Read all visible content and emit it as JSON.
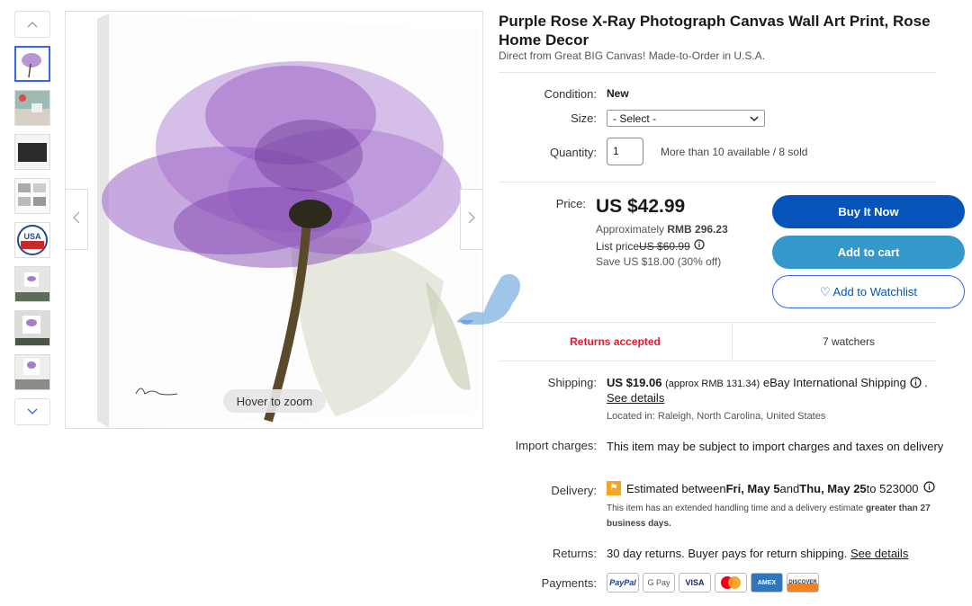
{
  "gallery": {
    "zoom_label": "Hover to zoom",
    "up_icon": "chevron-up-icon",
    "down_icon": "chevron-down-icon",
    "prev_icon": "chevron-left-icon",
    "next_icon": "chevron-right-icon",
    "thumbnails": [
      "purple-rose",
      "room-scene",
      "black-frame",
      "spec-sheet",
      "usa-badge",
      "wall-scene-1",
      "wall-scene-2",
      "wall-scene-3"
    ],
    "usa_text": "USA"
  },
  "product": {
    "title": "Purple Rose X-Ray Photograph Canvas Wall Art Print, Rose Home Decor",
    "subtitle": "Direct from Great BIG Canvas! Made-to-Order in U.S.A."
  },
  "options": {
    "condition_label": "Condition:",
    "condition_value": "New",
    "size_label": "Size:",
    "size_selected": "- Select -",
    "quantity_label": "Quantity:",
    "quantity_value": "1",
    "availability": "More than 10 available / 8 sold"
  },
  "price": {
    "label": "Price:",
    "value": "US $42.99",
    "approx_prefix": "Approximately ",
    "approx_value": "RMB 296.23",
    "list_prefix": "List price ",
    "list_value": "US $60.99",
    "save": "Save US $18.00 (30% off)"
  },
  "actions": {
    "buy_now": "Buy It Now",
    "add_to_cart": "Add to cart",
    "watchlist": "♡ Add to Watchlist"
  },
  "stats": {
    "returns": "Returns accepted",
    "watchers": "7 watchers"
  },
  "shipping": {
    "label": "Shipping:",
    "amount": "US $19.06",
    "approx": "(approx RMB 131.34)",
    "method": "eBay International Shipping",
    "details_link": "See details",
    "location": "Located in: Raleigh, North Carolina, United States"
  },
  "import": {
    "label": "Import charges:",
    "text": "This item may be subject to import charges and taxes on delivery"
  },
  "delivery": {
    "label": "Delivery:",
    "prefix": "Estimated between ",
    "date_from": "Fri, May 5",
    "and": " and ",
    "date_to": "Thu, May 25",
    "to_text": " to 523000",
    "note_prefix": "This item has an extended handling time and a delivery estimate ",
    "note_bold": "greater than 27 business days."
  },
  "returns": {
    "label": "Returns:",
    "text": "30 day returns. Buyer pays for return shipping.",
    "link": "See details"
  },
  "payments": {
    "label": "Payments:",
    "methods": [
      "PayPal",
      "G Pay",
      "VISA",
      "Mastercard",
      "AMEX",
      "DISCOVER"
    ]
  },
  "colors": {
    "primary_blue": "#0654ba",
    "secondary_blue": "#3498ca",
    "link_blue": "#3665f3",
    "returns_red": "#dd1e31"
  }
}
